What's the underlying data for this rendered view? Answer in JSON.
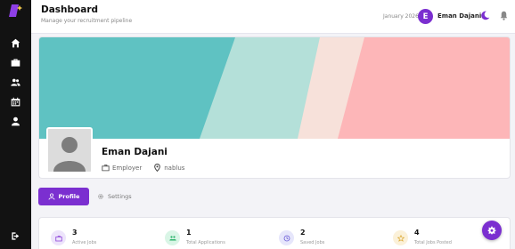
{
  "header": {
    "title": "Dashboard",
    "subtitle": "Manage your recruitment pipeline",
    "date": "January 2026",
    "avatar_initial": "E",
    "user_name": "Eman Dajani"
  },
  "sidebar": {
    "items": [
      {
        "icon": "home-icon"
      },
      {
        "icon": "briefcase-icon"
      },
      {
        "icon": "users-icon"
      },
      {
        "icon": "calendar-icon"
      },
      {
        "icon": "user-icon"
      }
    ],
    "logout_icon": "logout-icon"
  },
  "profile": {
    "name": "Eman Dajani",
    "role": "Employer",
    "location": "nablus"
  },
  "tabs": {
    "profile": "Profile",
    "settings": "Settings"
  },
  "stats": [
    {
      "value": "3",
      "label": "Active Jobs",
      "color": "#ede4fb",
      "icon_color": "#8b3fd9"
    },
    {
      "value": "1",
      "label": "Total Applications",
      "color": "#d9f5e6",
      "icon_color": "#2bb36b"
    },
    {
      "value": "2",
      "label": "Saved Jobs",
      "color": "#e6e6fb",
      "icon_color": "#6a5bd6"
    },
    {
      "value": "4",
      "label": "Total Jobs Posted",
      "color": "#fbf1d9",
      "icon_color": "#d9a52b"
    }
  ],
  "colors": {
    "accent": "#7b2fd0",
    "sidebar": "#121212",
    "banner_teal": "#5fc2c2",
    "banner_mint": "#b4e0d9",
    "banner_cream": "#f7e1da",
    "banner_pink": "#fdb6b8"
  }
}
